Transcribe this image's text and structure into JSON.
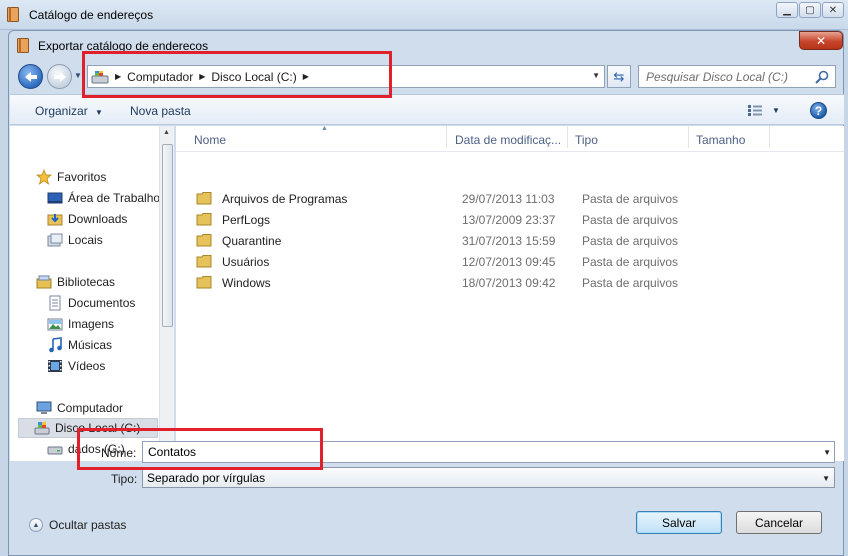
{
  "outer_window": {
    "title": "Catálogo de endereços"
  },
  "dialog": {
    "title": "Exportar catálogo de enderecos",
    "close_glyph": "✕"
  },
  "address": {
    "crumbs": [
      "Computador",
      "Disco Local (C:)"
    ],
    "drive_icon": "drive-icon"
  },
  "search": {
    "placeholder": "Pesquisar Disco Local (C:)",
    "icon": "search-icon"
  },
  "toolbar": {
    "organize_label": "Organizar",
    "new_folder_label": "Nova pasta",
    "help_glyph": "?"
  },
  "nav_pane": {
    "favorites": "Favoritos",
    "desktop": "Área de Trabalho",
    "downloads": "Downloads",
    "places": "Locais",
    "libraries": "Bibliotecas",
    "documents": "Documentos",
    "pictures": "Imagens",
    "music": "Músicas",
    "videos": "Vídeos",
    "computer": "Computador",
    "local_disk": "Disco Local (C:)",
    "data_drive": "dados (G:)"
  },
  "columns": {
    "name": "Nome",
    "date": "Data de modificaç...",
    "type": "Tipo",
    "size": "Tamanho"
  },
  "files": [
    {
      "name": "Arquivos de Programas",
      "date": "29/07/2013 11:03",
      "type": "Pasta de arquivos"
    },
    {
      "name": "PerfLogs",
      "date": "13/07/2009 23:37",
      "type": "Pasta de arquivos"
    },
    {
      "name": "Quarantine",
      "date": "31/07/2013 15:59",
      "type": "Pasta de arquivos"
    },
    {
      "name": "Usuários",
      "date": "12/07/2013 09:45",
      "type": "Pasta de arquivos"
    },
    {
      "name": "Windows",
      "date": "18/07/2013 09:42",
      "type": "Pasta de arquivos"
    }
  ],
  "form": {
    "name_label": "Nome:",
    "name_value": "Contatos",
    "type_label": "Tipo:",
    "type_value": "Separado por vírgulas"
  },
  "footer": {
    "hide_folders_label": "Ocultar pastas",
    "save_label": "Salvar",
    "cancel_label": "Cancelar"
  },
  "colors": {
    "annotation_red": "#e0202a",
    "window_frame": "#cfdded",
    "close_red": "#c7452c"
  }
}
